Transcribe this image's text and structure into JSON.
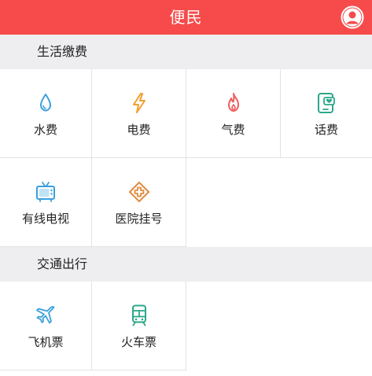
{
  "header": {
    "title": "便民",
    "bg_color": "#f74a4a",
    "avatar_icon": "user-avatar-icon"
  },
  "sections": [
    {
      "title": "生活缴费",
      "items": [
        {
          "label": "水费",
          "icon": "water-drop-icon",
          "color": "#3aa0de"
        },
        {
          "label": "电费",
          "icon": "lightning-bolt-icon",
          "color": "#f0a030"
        },
        {
          "label": "气费",
          "icon": "flame-icon",
          "color": "#ef5d5d"
        },
        {
          "label": "话费",
          "icon": "phone-heart-icon",
          "color": "#2aa889"
        },
        {
          "label": "有线电视",
          "icon": "tv-icon",
          "color": "#3aa0de"
        },
        {
          "label": "医院挂号",
          "icon": "medical-cross-icon",
          "color": "#e08a3c"
        }
      ]
    },
    {
      "title": "交通出行",
      "items": [
        {
          "label": "飞机票",
          "icon": "airplane-icon",
          "color": "#3aa0de"
        },
        {
          "label": "火车票",
          "icon": "train-icon",
          "color": "#2aa889"
        }
      ]
    }
  ]
}
